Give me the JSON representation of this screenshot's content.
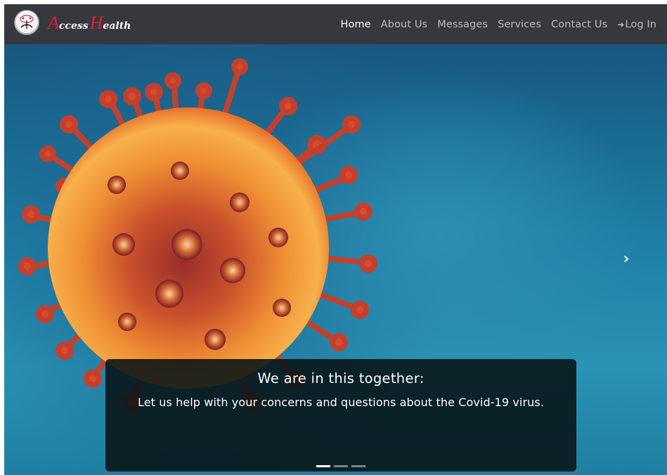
{
  "brand": {
    "name_first_cap": "A",
    "name_first_rest": "ccess",
    "name_second_cap": "H",
    "name_second_rest": "ealth",
    "logo_icon": "globe-logo-icon",
    "accent_color": "#e31b3a"
  },
  "nav": {
    "items": [
      {
        "label": "Home",
        "active": true
      },
      {
        "label": "About Us",
        "active": false
      },
      {
        "label": "Messages",
        "active": false
      },
      {
        "label": "Services",
        "active": false
      },
      {
        "label": "Contact Us",
        "active": false
      }
    ],
    "login_label": "Log In",
    "login_icon": "sign-in-icon",
    "background": "#36383d"
  },
  "carousel": {
    "caption_title": "We are in this together:",
    "caption_text": "Let us help with your concerns and questions about the Covid-19 virus.",
    "next_icon": "chevron-right-icon",
    "next_glyph": "›",
    "slide_count": 3,
    "active_slide": 1,
    "image": "coronavirus-illustration"
  }
}
